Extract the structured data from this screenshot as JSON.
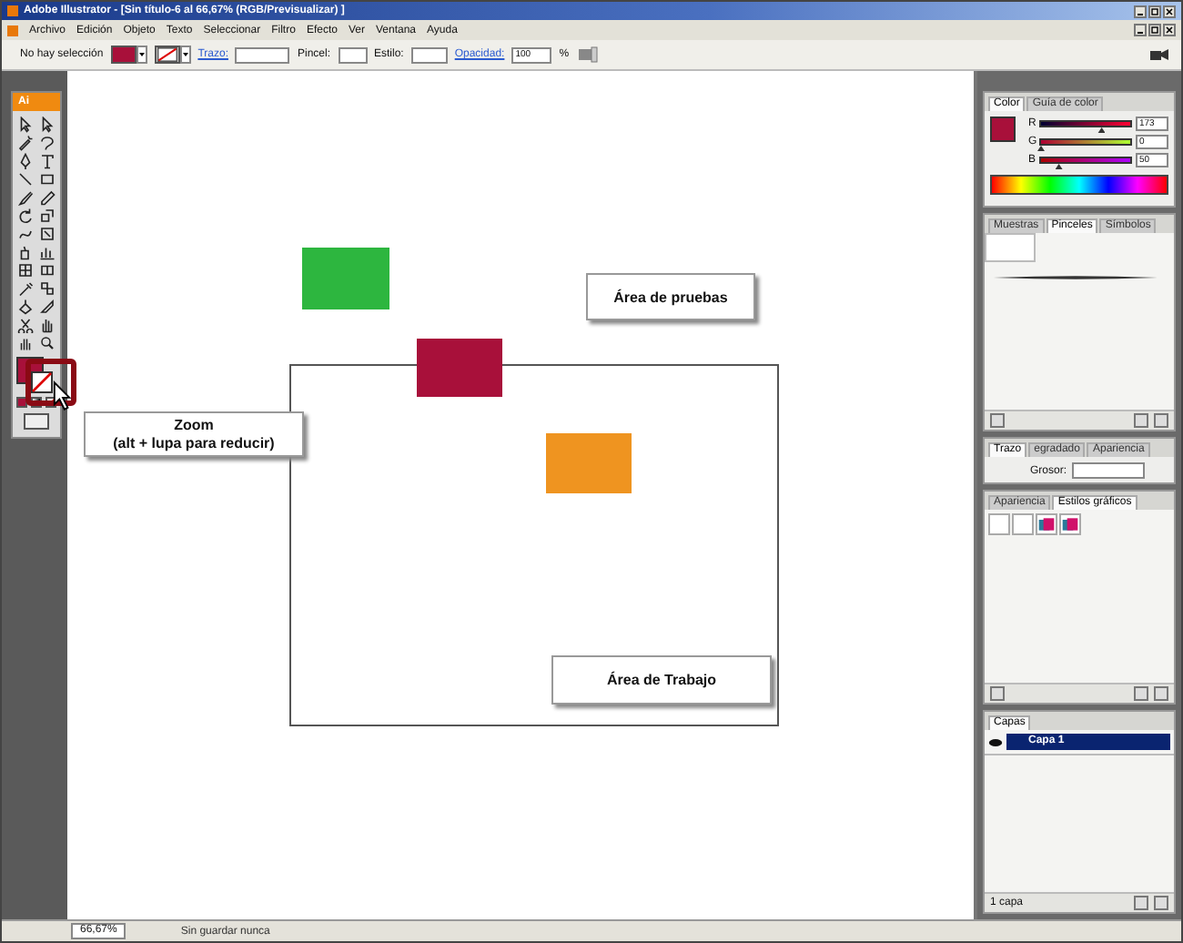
{
  "window": {
    "title": "Adobe Illustrator - [Sin título-6 al 66,67% (RGB/Previsualizar) ]"
  },
  "menu": [
    "Archivo",
    "Edición",
    "Objeto",
    "Texto",
    "Seleccionar",
    "Filtro",
    "Efecto",
    "Ver",
    "Ventana",
    "Ayuda"
  ],
  "control_bar": {
    "selection": "No hay selección",
    "color": "#a8103a",
    "stroke_label": "Trazo:",
    "brush_label": "Pincel:",
    "style_label": "Estilo:",
    "opacity_label": "Opacidad:",
    "opacity": "100",
    "percent": "%"
  },
  "toolbox": {
    "logo": "Ai",
    "color": "#a8103a"
  },
  "canvas": {
    "shapes": [
      {
        "color": "#2db63f"
      },
      {
        "color": "#a8103a"
      },
      {
        "color": "#ef9420"
      }
    ],
    "callouts": [
      {
        "text": "Área de pruebas"
      },
      {
        "text": "Área de Trabajo"
      }
    ],
    "tooltip": {
      "title": "Zoom",
      "hint": "(alt + lupa para reducir)"
    }
  },
  "panels": {
    "color": {
      "tabs": [
        {
          "label": "Color",
          "selected": true
        },
        {
          "label": "Guía de color",
          "selected": false
        }
      ],
      "color": "#a8103a",
      "channels": [
        {
          "name": "R",
          "value": "173",
          "level": 0.68
        },
        {
          "name": "G",
          "value": "0",
          "level": 0
        },
        {
          "name": "B",
          "value": "50",
          "level": 0.2
        }
      ]
    },
    "brushes": {
      "tabs": [
        {
          "label": "Muestras",
          "selected": false
        },
        {
          "label": "Pinceles",
          "selected": true
        },
        {
          "label": "Símbolos",
          "selected": false
        }
      ]
    },
    "stroke": {
      "tabs": [
        {
          "label": "Trazo",
          "selected": true
        },
        {
          "label": "egradado",
          "selected": false
        },
        {
          "label": "Apariencia",
          "selected": false
        }
      ],
      "weight_label": "Grosor:"
    },
    "styles": {
      "tabs": [
        {
          "label": "Apariencia",
          "selected": false
        },
        {
          "label": "Estilos gráficos",
          "selected": true
        }
      ]
    },
    "layers": {
      "tabs": [
        {
          "label": "Capas",
          "selected": true
        }
      ],
      "rows": [
        {
          "name": "Capa 1",
          "selected": true
        }
      ],
      "footer": "1 capa"
    }
  },
  "status_bar": {
    "zoom": "66,67%",
    "info": "Sin guardar nunca"
  }
}
